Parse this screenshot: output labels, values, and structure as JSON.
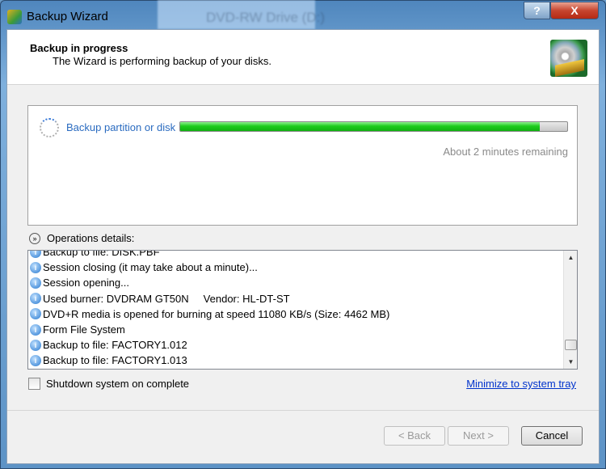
{
  "window": {
    "title": "Backup Wizard",
    "background_window_title": "DVD-RW Drive (D:)",
    "help_label": "?",
    "close_label": "X"
  },
  "header": {
    "title": "Backup in progress",
    "subtitle": "The Wizard is performing backup of your disks."
  },
  "progress": {
    "task": "Backup partition or disk",
    "percent": 93,
    "remaining": "About 2 minutes remaining",
    "bar_color": "#1ccc1c"
  },
  "operations": {
    "label": "Operations details:",
    "toggle_icon": "chevron-double-down",
    "rows": [
      "Backup to file: DISK.PBF",
      "Session closing (it may take about a minute)...",
      "Session opening...",
      "Used burner: DVDRAM GT50N     Vendor: HL-DT-ST",
      "DVD+R media is opened for burning at speed 11080 KB/s (Size: 4462 MB)",
      "Form File System",
      "Backup to file: FACTORY1.012",
      "Backup to file: FACTORY1.013"
    ]
  },
  "options": {
    "shutdown_label": "Shutdown system on complete",
    "shutdown_checked": false,
    "minimize_link": "Minimize to system tray"
  },
  "buttons": {
    "back": "< Back",
    "next": "Next >",
    "cancel": "Cancel"
  }
}
